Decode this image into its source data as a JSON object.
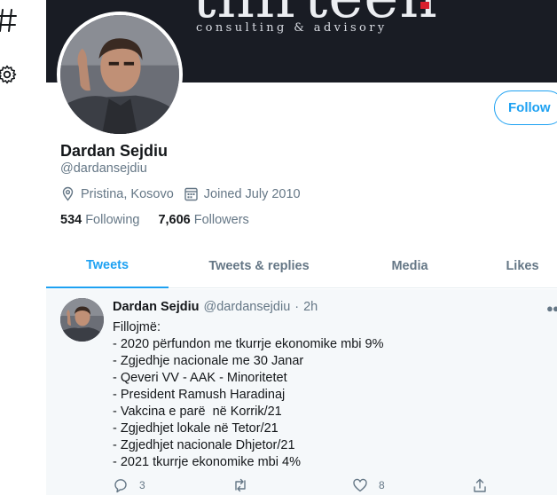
{
  "banner": {
    "logo_text": "thirteen",
    "tagline": "consulting & advisory"
  },
  "profile": {
    "name": "Dardan Sejdiu",
    "handle": "@dardansejdiu",
    "location": "Pristina, Kosovo",
    "joined": "Joined July 2010",
    "following_count": "534",
    "following_label": "Following",
    "followers_count": "7,606",
    "followers_label": "Followers",
    "follow_label": "Follow"
  },
  "tabs": [
    {
      "label": "Tweets",
      "active": true
    },
    {
      "label": "Tweets & replies",
      "active": false
    },
    {
      "label": "Media",
      "active": false
    },
    {
      "label": "Likes",
      "active": false
    }
  ],
  "tweet": {
    "author": "Dardan Sejdiu",
    "handle": "@dardansejdiu",
    "separator": "·",
    "time": "2h",
    "lines": [
      "Fillojmë:",
      "- 2020 përfundon me tkurrje ekonomike mbi 9%",
      "- Zgjedhje nacionale me 30 Janar",
      "- Qeveri VV - AAK - Minoritetet",
      "- President Ramush Haradinaj",
      "- Vakcina e parë  në Korrik/21",
      "- Zgjedhjet lokale në Tetor/21",
      "- Zgjedhjet nacionale Dhjetor/21",
      "- 2021 tkurrje ekonomike mbi 4%"
    ],
    "replies": "3",
    "retweets": "",
    "likes": "8"
  },
  "icons": {
    "nav": [
      "hashtag-icon",
      "settings-gear-icon"
    ],
    "meta": [
      "location-pin-icon",
      "calendar-icon"
    ],
    "actions": [
      "reply-icon",
      "retweet-icon",
      "like-heart-icon",
      "share-icon"
    ]
  },
  "colors": {
    "accent": "#1da1f2",
    "secondary_text": "#657786",
    "primary_text": "#14171a",
    "banner_bg": "#191c24",
    "logo_dot": "#d81e2c",
    "tweet_bg": "#f5f8fa"
  }
}
